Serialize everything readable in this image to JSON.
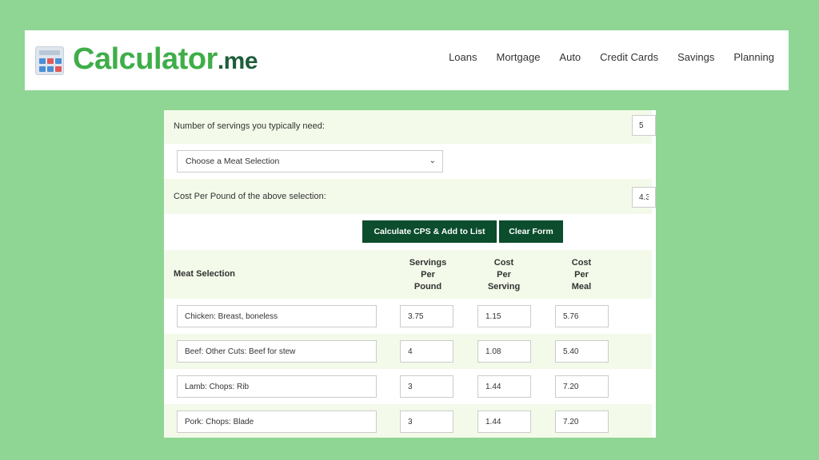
{
  "header": {
    "logo_main": "Calculator",
    "logo_suffix": ".me",
    "nav": [
      "Loans",
      "Mortgage",
      "Auto",
      "Credit Cards",
      "Savings",
      "Planning"
    ]
  },
  "form": {
    "servings_label": "Number of servings you typically need:",
    "servings_value": "5",
    "meat_select": "Choose a Meat Selection",
    "cost_label": "Cost Per Pound of the above selection:",
    "cost_value": "4.3",
    "calc_button": "Calculate CPS & Add to List",
    "clear_button": "Clear Form"
  },
  "table": {
    "headers": {
      "meat": "Meat Selection",
      "servings_per_pound": [
        "Servings",
        "Per",
        "Pound"
      ],
      "cost_per_serving": [
        "Cost",
        "Per",
        "Serving"
      ],
      "cost_per_meal": [
        "Cost",
        "Per",
        "Meal"
      ]
    },
    "rows": [
      {
        "meat": "Chicken: Breast, boneless",
        "spp": "3.75",
        "cps": "1.15",
        "cpm": "5.76"
      },
      {
        "meat": "Beef: Other Cuts: Beef for stew",
        "spp": "4",
        "cps": "1.08",
        "cpm": "5.40"
      },
      {
        "meat": "Lamb: Chops: Rib",
        "spp": "3",
        "cps": "1.44",
        "cpm": "7.20"
      },
      {
        "meat": "Pork: Chops: Blade",
        "spp": "3",
        "cps": "1.44",
        "cpm": "7.20"
      }
    ]
  }
}
